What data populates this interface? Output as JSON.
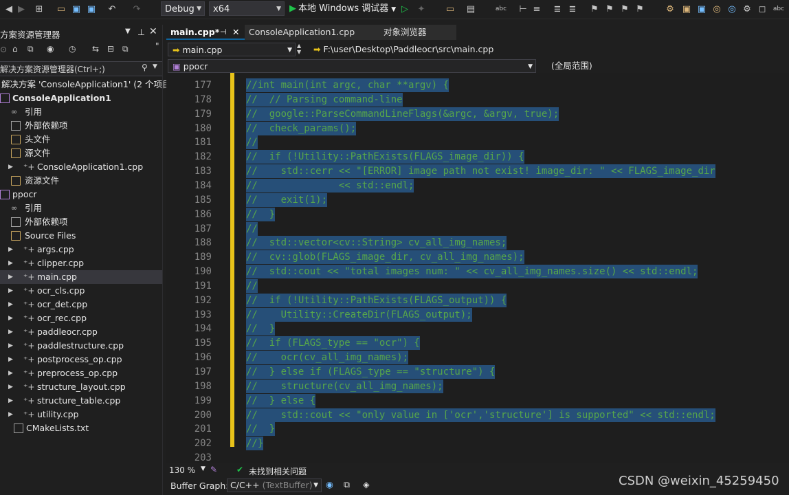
{
  "toolbar": {
    "config": "Debug",
    "platform": "x64",
    "run_label": "本地 Windows 调试器",
    "icons": [
      "back-icon",
      "forward-icon",
      "new-project-icon",
      "open-icon",
      "save-icon",
      "save-all-icon",
      "undo-icon",
      "redo-icon",
      "start-without-debug-icon",
      "hot-reload-icon",
      "folder-icon",
      "layout-icon",
      "spellcheck-icon",
      "step-icon",
      "comment-icon",
      "bookmark-icon"
    ]
  },
  "solution_explorer": {
    "title": "方案资源管理器",
    "search_placeholder": "解决方案资源管理器(Ctrl+;)",
    "items": [
      {
        "label": "解决方案 'ConsoleApplication1' (2 个项目",
        "kind": "solution"
      },
      {
        "label": "ConsoleApplication1",
        "kind": "project",
        "bold": true
      },
      {
        "label": "引用",
        "kind": "ref"
      },
      {
        "label": "外部依赖项",
        "kind": "ext"
      },
      {
        "label": "头文件",
        "kind": "folder"
      },
      {
        "label": "源文件",
        "kind": "folder"
      },
      {
        "label": "ConsoleApplication1.cpp",
        "kind": "cpp"
      },
      {
        "label": "资源文件",
        "kind": "folder"
      },
      {
        "label": "ppocr",
        "kind": "project"
      },
      {
        "label": "引用",
        "kind": "ref"
      },
      {
        "label": "外部依赖项",
        "kind": "ext"
      },
      {
        "label": "Source Files",
        "kind": "folder"
      },
      {
        "label": "args.cpp",
        "kind": "cpp"
      },
      {
        "label": "clipper.cpp",
        "kind": "cpp"
      },
      {
        "label": "main.cpp",
        "kind": "cpp",
        "selected": true
      },
      {
        "label": "ocr_cls.cpp",
        "kind": "cpp"
      },
      {
        "label": "ocr_det.cpp",
        "kind": "cpp"
      },
      {
        "label": "ocr_rec.cpp",
        "kind": "cpp"
      },
      {
        "label": "paddleocr.cpp",
        "kind": "cpp"
      },
      {
        "label": "paddlestructure.cpp",
        "kind": "cpp"
      },
      {
        "label": "postprocess_op.cpp",
        "kind": "cpp"
      },
      {
        "label": "preprocess_op.cpp",
        "kind": "cpp"
      },
      {
        "label": "structure_layout.cpp",
        "kind": "cpp"
      },
      {
        "label": "structure_table.cpp",
        "kind": "cpp"
      },
      {
        "label": "utility.cpp",
        "kind": "cpp"
      },
      {
        "label": "CMakeLists.txt",
        "kind": "file"
      }
    ]
  },
  "tabs": [
    {
      "label": "main.cpp*",
      "active": true
    },
    {
      "label": "ConsoleApplication1.cpp",
      "active": false
    },
    {
      "label": "对象浏览器",
      "active": false
    }
  ],
  "nav": {
    "file_dropdown": "main.cpp",
    "path": "F:\\user\\Desktop\\Paddleocr\\src\\main.cpp",
    "project_dropdown": "ppocr",
    "scope": "(全局范围)"
  },
  "editor": {
    "lines": [
      {
        "num": "177",
        "text": "//int main(int argc, char **argv) {"
      },
      {
        "num": "178",
        "text": "//  // Parsing command-line"
      },
      {
        "num": "179",
        "text": "//  google::ParseCommandLineFlags(&argc, &argv, true);"
      },
      {
        "num": "180",
        "text": "//  check_params();"
      },
      {
        "num": "181",
        "text": "//"
      },
      {
        "num": "182",
        "text": "//  if (!Utility::PathExists(FLAGS_image_dir)) {"
      },
      {
        "num": "183",
        "text": "//    std::cerr << \"[ERROR] image path not exist! image_dir: \" << FLAGS_image_dir"
      },
      {
        "num": "184",
        "text": "//              << std::endl;"
      },
      {
        "num": "185",
        "text": "//    exit(1);"
      },
      {
        "num": "186",
        "text": "//  }"
      },
      {
        "num": "187",
        "text": "//"
      },
      {
        "num": "188",
        "text": "//  std::vector<cv::String> cv_all_img_names;"
      },
      {
        "num": "189",
        "text": "//  cv::glob(FLAGS_image_dir, cv_all_img_names);"
      },
      {
        "num": "190",
        "text": "//  std::cout << \"total images num: \" << cv_all_img_names.size() << std::endl;"
      },
      {
        "num": "191",
        "text": "//"
      },
      {
        "num": "192",
        "text": "//  if (!Utility::PathExists(FLAGS_output)) {"
      },
      {
        "num": "193",
        "text": "//    Utility::CreateDir(FLAGS_output);"
      },
      {
        "num": "194",
        "text": "//  }"
      },
      {
        "num": "195",
        "text": "//  if (FLAGS_type == \"ocr\") {"
      },
      {
        "num": "196",
        "text": "//    ocr(cv_all_img_names);"
      },
      {
        "num": "197",
        "text": "//  } else if (FLAGS_type == \"structure\") {"
      },
      {
        "num": "198",
        "text": "//    structure(cv_all_img_names);"
      },
      {
        "num": "199",
        "text": "//  } else {"
      },
      {
        "num": "200",
        "text": "//    std::cout << \"only value in ['ocr','structure'] is supported\" << std::endl;"
      },
      {
        "num": "201",
        "text": "//  }"
      },
      {
        "num": "202",
        "text": "//}"
      },
      {
        "num": "203",
        "text": ""
      }
    ]
  },
  "status": {
    "zoom": "130 %",
    "issues": "未找到相关问题"
  },
  "bottom": {
    "buffer_label": "Buffer Graph:",
    "buffer_value_main": "C/C++",
    "buffer_value_sub": "(TextBuffer)"
  },
  "watermark": "CSDN @weixin_45259450",
  "colors": {
    "selection": "#264f78",
    "comment": "#57a64a",
    "change_bar": "#e8c31a",
    "accent": "#0e639c"
  }
}
